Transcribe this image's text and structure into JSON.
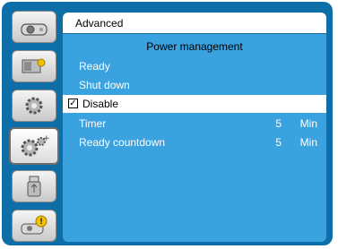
{
  "menu": {
    "title": "Advanced",
    "section_header": "Power management",
    "items": [
      {
        "label": "Ready"
      },
      {
        "label": "Shut down"
      },
      {
        "label": "Disable",
        "checked": true
      },
      {
        "label": "Timer",
        "value": "5",
        "unit": "Min"
      },
      {
        "label": "Ready countdown",
        "value": "5",
        "unit": "Min"
      }
    ]
  },
  "sidebar": {
    "tabs": [
      {
        "icon": "projector-icon"
      },
      {
        "icon": "display-adjust-icon"
      },
      {
        "icon": "settings-gear-icon"
      },
      {
        "icon": "advanced-gears-icon",
        "active": true
      },
      {
        "icon": "usb-icon"
      },
      {
        "icon": "info-icon"
      }
    ]
  },
  "colors": {
    "frame": "#0d6ea8",
    "content_bg": "#3aa2de",
    "highlight": "#ffffff"
  }
}
